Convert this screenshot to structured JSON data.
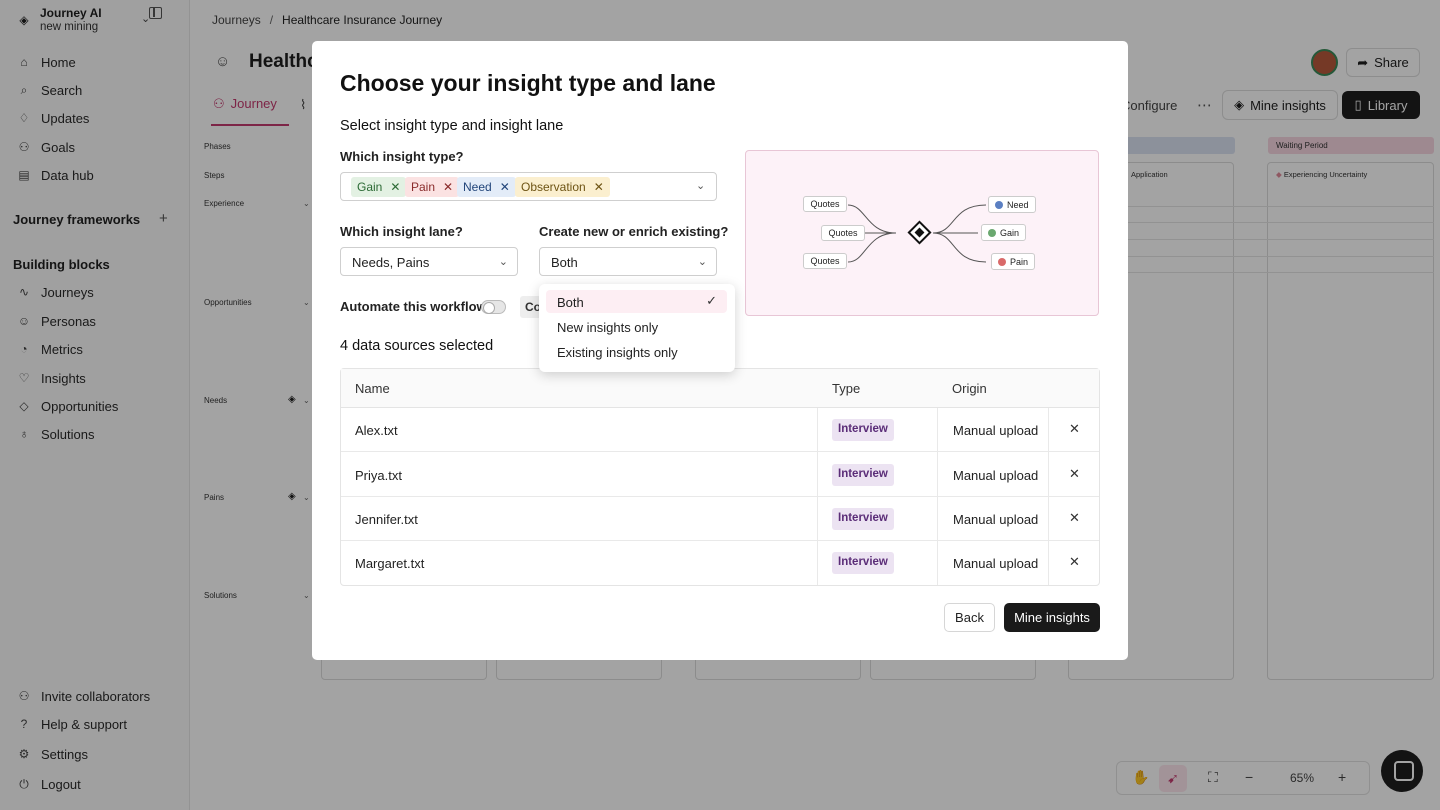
{
  "workspace": {
    "name": "Journey AI",
    "sub": "new mining"
  },
  "sidebar": {
    "items": [
      {
        "label": "Home",
        "icon": "home-icon",
        "glyph": "⌂"
      },
      {
        "label": "Search",
        "icon": "search-icon",
        "glyph": "⌕"
      },
      {
        "label": "Updates",
        "icon": "bell-icon",
        "glyph": "♢"
      },
      {
        "label": "Goals",
        "icon": "target-icon",
        "glyph": "⚇"
      },
      {
        "label": "Data hub",
        "icon": "database-icon",
        "glyph": "▤"
      }
    ],
    "frameworks_title": "Journey frameworks",
    "blocks_title": "Building blocks",
    "blocks": [
      {
        "label": "Journeys",
        "icon": "route-icon",
        "glyph": "∿"
      },
      {
        "label": "Personas",
        "icon": "persona-icon",
        "glyph": "☺"
      },
      {
        "label": "Metrics",
        "icon": "metrics-icon",
        "glyph": "◔"
      },
      {
        "label": "Insights",
        "icon": "insights-icon",
        "glyph": "♡"
      },
      {
        "label": "Opportunities",
        "icon": "opportunity-icon",
        "glyph": "◇"
      },
      {
        "label": "Solutions",
        "icon": "bulb-icon",
        "glyph": "♁"
      }
    ],
    "footer": [
      {
        "label": "Invite collaborators",
        "icon": "invite-icon",
        "glyph": "⚇"
      },
      {
        "label": "Help & support",
        "icon": "help-icon",
        "glyph": "?"
      },
      {
        "label": "Settings",
        "icon": "gear-icon",
        "glyph": "⚙"
      },
      {
        "label": "Logout",
        "icon": "logout-icon",
        "glyph": "⏻"
      }
    ]
  },
  "breadcrumb": {
    "root": "Journeys",
    "sep": "/",
    "current": "Healthcare Insurance Journey"
  },
  "page": {
    "title": "Healthc"
  },
  "header": {
    "share": "Share",
    "tab_journey": "Journey",
    "configure": "Configure",
    "mine": "Mine insights",
    "library": "Library"
  },
  "canvas": {
    "rows": [
      "Phases",
      "Steps",
      "Experience",
      "Opportunities",
      "Needs",
      "Pains",
      "Solutions"
    ],
    "phase_last": "Waiting Period",
    "step_a": "Application",
    "step_b": "Experiencing Uncertainty"
  },
  "zoom": {
    "value": "65%"
  },
  "modal": {
    "title": "Choose your insight type and lane",
    "subtitle": "Select insight type and insight lane",
    "q_type": "Which insight type?",
    "chips": [
      {
        "label": "Gain",
        "bg": "#e3f1e3",
        "fg": "#2c6a35"
      },
      {
        "label": "Pain",
        "bg": "#fbe2e2",
        "fg": "#8a2b2b"
      },
      {
        "label": "Need",
        "bg": "#e3ecf8",
        "fg": "#22457a"
      },
      {
        "label": "Observation",
        "bg": "#fbefcf",
        "fg": "#6e5414"
      }
    ],
    "q_lane": "Which insight lane?",
    "lane_value": "Needs, Pains",
    "q_create": "Create new or enrich existing?",
    "create_value": "Both",
    "automate": "Automate this workflow",
    "co_pill": "Co",
    "sources": "4 data sources selected",
    "diagram": {
      "quotes": [
        "Quotes",
        "Quotes",
        "Quotes"
      ],
      "need": "Need",
      "gain": "Gain",
      "pain": "Pain"
    },
    "table": {
      "headers": {
        "name": "Name",
        "type": "Type",
        "origin": "Origin"
      },
      "rows": [
        {
          "name": "Alex.txt",
          "type": "Interview",
          "origin": "Manual upload"
        },
        {
          "name": "Priya.txt",
          "type": "Interview",
          "origin": "Manual upload"
        },
        {
          "name": "Jennifer.txt",
          "type": "Interview",
          "origin": "Manual upload"
        },
        {
          "name": "Margaret.txt",
          "type": "Interview",
          "origin": "Manual upload"
        }
      ]
    },
    "back": "Back",
    "mine": "Mine insights"
  },
  "dropdown": {
    "options": [
      {
        "label": "Both",
        "selected": true
      },
      {
        "label": "New insights only",
        "selected": false
      },
      {
        "label": "Existing insights only",
        "selected": false
      }
    ]
  }
}
